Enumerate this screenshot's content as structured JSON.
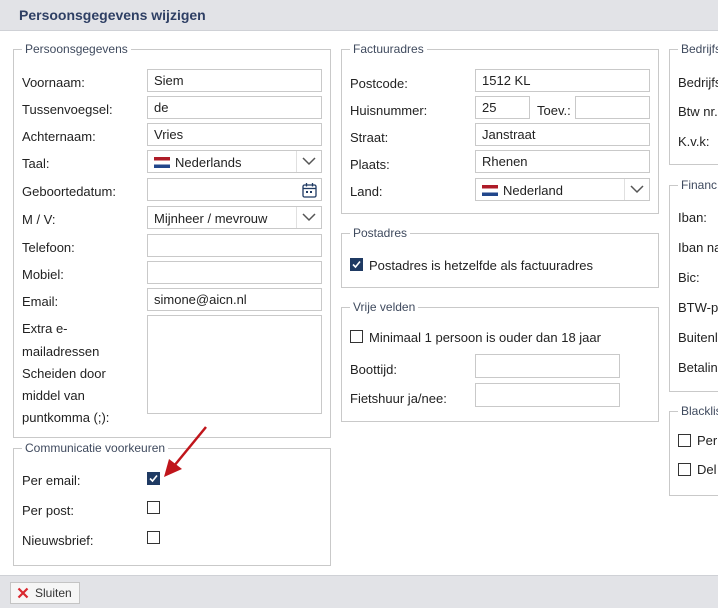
{
  "window": {
    "title": "Persoonsgegevens wijzigen"
  },
  "personal": {
    "legend": "Persoonsgegevens",
    "first_name_label": "Voornaam:",
    "first_name": "Siem",
    "infix_label": "Tussenvoegsel:",
    "infix": "de",
    "last_name_label": "Achternaam:",
    "last_name": "Vries",
    "language_label": "Taal:",
    "language": "Nederlands",
    "birthdate_label": "Geboortedatum:",
    "birthdate": "",
    "gender_label": "M / V:",
    "gender": "Mijnheer / mevrouw",
    "phone_label": "Telefoon:",
    "phone": "",
    "mobile_label": "Mobiel:",
    "mobile": "",
    "email_label": "Email:",
    "email": "simone@aicn.nl",
    "extra_email_label_lines": [
      "Extra e-",
      "mailadressen",
      "Scheiden door",
      "middel van",
      "puntkomma (;):"
    ],
    "extra_email": ""
  },
  "communication": {
    "legend": "Communicatie voorkeuren",
    "per_email_label": "Per email:",
    "per_email_checked": true,
    "per_post_label": "Per post:",
    "per_post_checked": false,
    "newsletter_label": "Nieuwsbrief:",
    "newsletter_checked": false
  },
  "billing": {
    "legend": "Factuuradres",
    "postcode_label": "Postcode:",
    "postcode": "1512 KL",
    "housenumber_label": "Huisnummer:",
    "housenumber": "25",
    "addition_label": "Toev.:",
    "addition": "",
    "street_label": "Straat:",
    "street": "Janstraat",
    "city_label": "Plaats:",
    "city": "Rhenen",
    "country_label": "Land:",
    "country": "Nederland"
  },
  "postal": {
    "legend": "Postadres",
    "same_label": "Postadres is hetzelfde als factuuradres",
    "same_checked": true
  },
  "free_fields": {
    "legend": "Vrije velden",
    "adult_label": "Minimaal 1 persoon is ouder dan 18 jaar",
    "adult_checked": false,
    "boat_time_label": "Boottijd:",
    "boat_time": "",
    "bike_label": "Fietshuur ja/nee:",
    "bike": ""
  },
  "company": {
    "legend": "Bedrijfs",
    "company_label": "Bedrijfs",
    "vat_label": "Btw nr.",
    "coc_label": "K.v.k:"
  },
  "finance": {
    "legend": "Financ",
    "iban_label": "Iban:",
    "iban_name_label": "Iban na",
    "bic_label": "Bic:",
    "btw_label": "BTW-p",
    "abroad_label": "Buitenl",
    "payment_label": "Betalin"
  },
  "blacklist": {
    "legend": "Blacklis",
    "opt1_label": "Per",
    "opt1_checked": false,
    "opt2_label": "Del",
    "opt2_checked": false
  },
  "footer": {
    "close_label": "Sluiten"
  },
  "colors": {
    "checked": "#1f3a63",
    "annotation_arrow": "#c0151b",
    "titlebar": "#e2e3e7"
  },
  "icons": [
    "calendar-icon",
    "chevron-down-icon",
    "check-icon",
    "close-icon",
    "flag-nl-icon",
    "arrow-annotation-icon"
  ]
}
